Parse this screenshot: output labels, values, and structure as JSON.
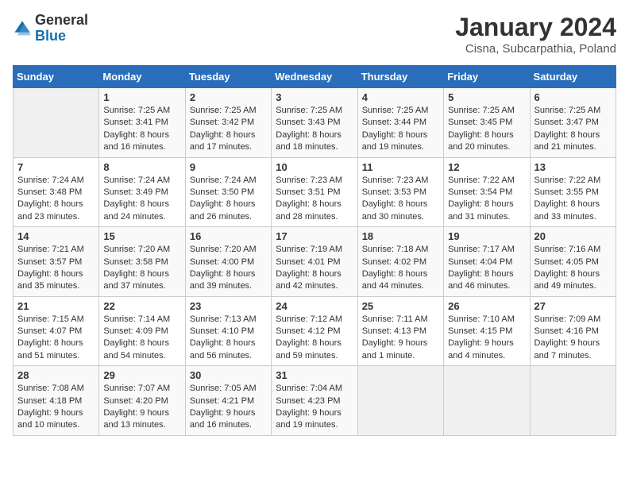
{
  "header": {
    "logo_general": "General",
    "logo_blue": "Blue",
    "title": "January 2024",
    "subtitle": "Cisna, Subcarpathia, Poland"
  },
  "days_of_week": [
    "Sunday",
    "Monday",
    "Tuesday",
    "Wednesday",
    "Thursday",
    "Friday",
    "Saturday"
  ],
  "weeks": [
    [
      {
        "day": "",
        "info": ""
      },
      {
        "day": "1",
        "info": "Sunrise: 7:25 AM\nSunset: 3:41 PM\nDaylight: 8 hours\nand 16 minutes."
      },
      {
        "day": "2",
        "info": "Sunrise: 7:25 AM\nSunset: 3:42 PM\nDaylight: 8 hours\nand 17 minutes."
      },
      {
        "day": "3",
        "info": "Sunrise: 7:25 AM\nSunset: 3:43 PM\nDaylight: 8 hours\nand 18 minutes."
      },
      {
        "day": "4",
        "info": "Sunrise: 7:25 AM\nSunset: 3:44 PM\nDaylight: 8 hours\nand 19 minutes."
      },
      {
        "day": "5",
        "info": "Sunrise: 7:25 AM\nSunset: 3:45 PM\nDaylight: 8 hours\nand 20 minutes."
      },
      {
        "day": "6",
        "info": "Sunrise: 7:25 AM\nSunset: 3:47 PM\nDaylight: 8 hours\nand 21 minutes."
      }
    ],
    [
      {
        "day": "7",
        "info": "Sunrise: 7:24 AM\nSunset: 3:48 PM\nDaylight: 8 hours\nand 23 minutes."
      },
      {
        "day": "8",
        "info": "Sunrise: 7:24 AM\nSunset: 3:49 PM\nDaylight: 8 hours\nand 24 minutes."
      },
      {
        "day": "9",
        "info": "Sunrise: 7:24 AM\nSunset: 3:50 PM\nDaylight: 8 hours\nand 26 minutes."
      },
      {
        "day": "10",
        "info": "Sunrise: 7:23 AM\nSunset: 3:51 PM\nDaylight: 8 hours\nand 28 minutes."
      },
      {
        "day": "11",
        "info": "Sunrise: 7:23 AM\nSunset: 3:53 PM\nDaylight: 8 hours\nand 30 minutes."
      },
      {
        "day": "12",
        "info": "Sunrise: 7:22 AM\nSunset: 3:54 PM\nDaylight: 8 hours\nand 31 minutes."
      },
      {
        "day": "13",
        "info": "Sunrise: 7:22 AM\nSunset: 3:55 PM\nDaylight: 8 hours\nand 33 minutes."
      }
    ],
    [
      {
        "day": "14",
        "info": "Sunrise: 7:21 AM\nSunset: 3:57 PM\nDaylight: 8 hours\nand 35 minutes."
      },
      {
        "day": "15",
        "info": "Sunrise: 7:20 AM\nSunset: 3:58 PM\nDaylight: 8 hours\nand 37 minutes."
      },
      {
        "day": "16",
        "info": "Sunrise: 7:20 AM\nSunset: 4:00 PM\nDaylight: 8 hours\nand 39 minutes."
      },
      {
        "day": "17",
        "info": "Sunrise: 7:19 AM\nSunset: 4:01 PM\nDaylight: 8 hours\nand 42 minutes."
      },
      {
        "day": "18",
        "info": "Sunrise: 7:18 AM\nSunset: 4:02 PM\nDaylight: 8 hours\nand 44 minutes."
      },
      {
        "day": "19",
        "info": "Sunrise: 7:17 AM\nSunset: 4:04 PM\nDaylight: 8 hours\nand 46 minutes."
      },
      {
        "day": "20",
        "info": "Sunrise: 7:16 AM\nSunset: 4:05 PM\nDaylight: 8 hours\nand 49 minutes."
      }
    ],
    [
      {
        "day": "21",
        "info": "Sunrise: 7:15 AM\nSunset: 4:07 PM\nDaylight: 8 hours\nand 51 minutes."
      },
      {
        "day": "22",
        "info": "Sunrise: 7:14 AM\nSunset: 4:09 PM\nDaylight: 8 hours\nand 54 minutes."
      },
      {
        "day": "23",
        "info": "Sunrise: 7:13 AM\nSunset: 4:10 PM\nDaylight: 8 hours\nand 56 minutes."
      },
      {
        "day": "24",
        "info": "Sunrise: 7:12 AM\nSunset: 4:12 PM\nDaylight: 8 hours\nand 59 minutes."
      },
      {
        "day": "25",
        "info": "Sunrise: 7:11 AM\nSunset: 4:13 PM\nDaylight: 9 hours\nand 1 minute."
      },
      {
        "day": "26",
        "info": "Sunrise: 7:10 AM\nSunset: 4:15 PM\nDaylight: 9 hours\nand 4 minutes."
      },
      {
        "day": "27",
        "info": "Sunrise: 7:09 AM\nSunset: 4:16 PM\nDaylight: 9 hours\nand 7 minutes."
      }
    ],
    [
      {
        "day": "28",
        "info": "Sunrise: 7:08 AM\nSunset: 4:18 PM\nDaylight: 9 hours\nand 10 minutes."
      },
      {
        "day": "29",
        "info": "Sunrise: 7:07 AM\nSunset: 4:20 PM\nDaylight: 9 hours\nand 13 minutes."
      },
      {
        "day": "30",
        "info": "Sunrise: 7:05 AM\nSunset: 4:21 PM\nDaylight: 9 hours\nand 16 minutes."
      },
      {
        "day": "31",
        "info": "Sunrise: 7:04 AM\nSunset: 4:23 PM\nDaylight: 9 hours\nand 19 minutes."
      },
      {
        "day": "",
        "info": ""
      },
      {
        "day": "",
        "info": ""
      },
      {
        "day": "",
        "info": ""
      }
    ]
  ]
}
